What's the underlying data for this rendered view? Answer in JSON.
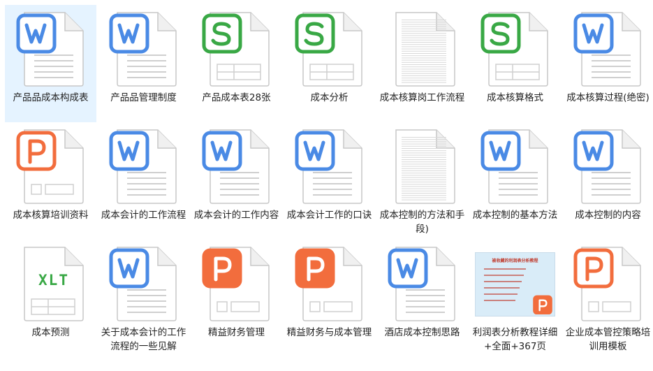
{
  "files": [
    {
      "label": "产品品成本构成表",
      "type": "word",
      "selected": true
    },
    {
      "label": "产品品管理制度",
      "type": "word"
    },
    {
      "label": "产品成本表28张",
      "type": "excel"
    },
    {
      "label": "成本分析",
      "type": "excel"
    },
    {
      "label": "成本核算岗工作流程",
      "type": "doc"
    },
    {
      "label": "成本核算格式",
      "type": "excel"
    },
    {
      "label": "成本核算过程(绝密)",
      "type": "word"
    },
    {
      "label": "成本核算培训资料",
      "type": "ppt"
    },
    {
      "label": "成本会计的工作流程",
      "type": "word"
    },
    {
      "label": "成本会计的工作内容",
      "type": "word"
    },
    {
      "label": "成本会计工作的口诀",
      "type": "word"
    },
    {
      "label": "成本控制的方法和手段)",
      "type": "doc"
    },
    {
      "label": "成本控制的基本方法",
      "type": "word"
    },
    {
      "label": "成本控制的内容",
      "type": "word"
    },
    {
      "label": "成本预测",
      "type": "xlt",
      "icon_text": "XLT"
    },
    {
      "label": "关于成本会计的工作流程的一些见解",
      "type": "word"
    },
    {
      "label": "精益财务管理",
      "type": "ppt-solid"
    },
    {
      "label": "精益财务与成本管理",
      "type": "ppt-solid"
    },
    {
      "label": "酒店成本控制思路",
      "type": "word"
    },
    {
      "label": "利润表分析教程详细+全面+367页",
      "type": "thumb",
      "thumb_title": "被收藏的利润表分析教程"
    },
    {
      "label": "企业成本管控策略培训用模板",
      "type": "ppt"
    }
  ],
  "colors": {
    "word": "#4a8ae5",
    "excel": "#39a845",
    "ppt": "#f26d3d",
    "xlt": "#39a845",
    "selected_bg": "#e5f3ff"
  }
}
